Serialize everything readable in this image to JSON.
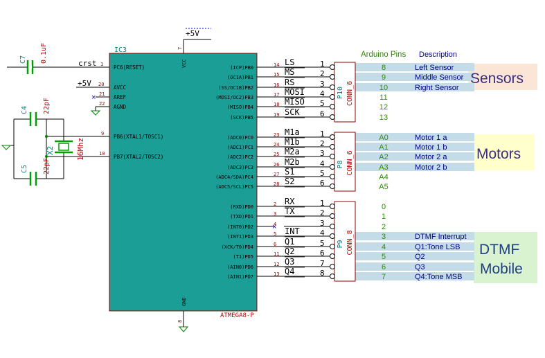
{
  "chip": {
    "ref": "IC3",
    "part": "ATMEGA8-P",
    "vcc_label": "VCC",
    "gnd_label": "GND",
    "vcc_pin": "7",
    "gnd_pin": "8",
    "supply": "+5V",
    "left_pins": [
      {
        "num": "1",
        "name": "PC6(RESET)",
        "net": "crst"
      },
      {
        "num": "20",
        "name": "AVCC",
        "net": "+5V"
      },
      {
        "num": "21",
        "name": "AREF",
        "net": ""
      },
      {
        "num": "22",
        "name": "AGND",
        "net": ""
      },
      {
        "num": "9",
        "name": "PB6(XTAL1/TOSC1)",
        "net": ""
      },
      {
        "num": "10",
        "name": "PB7(XTAL2/TOSC2)",
        "net": ""
      }
    ],
    "right_pins": [
      {
        "num": "14",
        "name": "(ICP)PB0",
        "net": "LS"
      },
      {
        "num": "15",
        "name": "(OC1A)PB1",
        "net": "MS"
      },
      {
        "num": "16",
        "name": "(SS/OC1B)PB2",
        "net": "RS"
      },
      {
        "num": "17",
        "name": "(MOSI/OC2)PB3",
        "net": "MOSI"
      },
      {
        "num": "18",
        "name": "(MISO)PB4",
        "net": "MISO"
      },
      {
        "num": "19",
        "name": "(SCK)PB5",
        "net": "SCK"
      },
      {
        "num": "23",
        "name": "(ADC0)PC0",
        "net": "M1a"
      },
      {
        "num": "24",
        "name": "(ADC1)PC1",
        "net": "M1b"
      },
      {
        "num": "25",
        "name": "(ADC2)PC2",
        "net": "M2a"
      },
      {
        "num": "26",
        "name": "(ADC3)PC3",
        "net": "M2b"
      },
      {
        "num": "27",
        "name": "(ADC4/SDA)PC4",
        "net": "S1"
      },
      {
        "num": "28",
        "name": "(ADC5/SCL)PC5",
        "net": "S2"
      },
      {
        "num": "2",
        "name": "(RXD)PD0",
        "net": "RX"
      },
      {
        "num": "3",
        "name": "(TXD)PD1",
        "net": "TX"
      },
      {
        "num": "4",
        "name": "(INT0)PD2",
        "net": ""
      },
      {
        "num": "5",
        "name": "(INT1)PD3",
        "net": "INT"
      },
      {
        "num": "6",
        "name": "(XCK/T0)PD4",
        "net": "Q1"
      },
      {
        "num": "11",
        "name": "(T1)PD5",
        "net": "Q2"
      },
      {
        "num": "12",
        "name": "(AIN0)PD6",
        "net": "Q3"
      },
      {
        "num": "13",
        "name": "(AIN1)PD7",
        "net": "Q4"
      }
    ]
  },
  "components": {
    "c7": {
      "ref": "C7",
      "value": "0.1uF"
    },
    "c4": {
      "ref": "C4",
      "value": "22pF"
    },
    "c5": {
      "ref": "C5",
      "value": "22pF"
    },
    "x2": {
      "ref": "X2",
      "value": "16Mhz"
    }
  },
  "connectors": [
    {
      "ref": "P10",
      "type": "CONN_6",
      "pins": [
        "1",
        "2",
        "3",
        "4",
        "5",
        "6"
      ]
    },
    {
      "ref": "P8",
      "type": "CONN_6",
      "pins": [
        "1",
        "2",
        "3",
        "4",
        "5",
        "6"
      ]
    },
    {
      "ref": "P9",
      "type": "CONN_8",
      "pins": [
        "1",
        "2",
        "3",
        "4",
        "5",
        "6",
        "7",
        "8"
      ]
    }
  ],
  "table_headers": {
    "arduino": "Arduino Pins",
    "description": "Description"
  },
  "group1": {
    "title": "Sensors",
    "color": "#fbe5d6",
    "rows": [
      {
        "pin": "8",
        "desc": "Left Sensor"
      },
      {
        "pin": "9",
        "desc": "Middle Sensor"
      },
      {
        "pin": "10",
        "desc": "Right Sensor"
      },
      {
        "pin": "11",
        "desc": ""
      },
      {
        "pin": "12",
        "desc": ""
      },
      {
        "pin": "13",
        "desc": ""
      }
    ]
  },
  "group2": {
    "title": "Motors",
    "color": "#ffffcc",
    "rows": [
      {
        "pin": "A0",
        "desc": "Motor 1 a"
      },
      {
        "pin": "A1",
        "desc": "Motor 1 b"
      },
      {
        "pin": "A2",
        "desc": "Motor 2 a"
      },
      {
        "pin": "A3",
        "desc": "Motor 2 b"
      },
      {
        "pin": "A4",
        "desc": ""
      },
      {
        "pin": "A5",
        "desc": ""
      }
    ]
  },
  "group3": {
    "title1": "DTMF",
    "title2": "Mobile",
    "color": "#d9f2d0",
    "rows": [
      {
        "pin": "0",
        "desc": ""
      },
      {
        "pin": "1",
        "desc": ""
      },
      {
        "pin": "2",
        "desc": ""
      },
      {
        "pin": "3",
        "desc": "DTMF Interrupt"
      },
      {
        "pin": "4",
        "desc": "Q1:Tone LSB"
      },
      {
        "pin": "5",
        "desc": "Q2"
      },
      {
        "pin": "6",
        "desc": "Q3"
      },
      {
        "pin": "7",
        "desc": "Q4:Tone MSB"
      }
    ]
  },
  "colors": {
    "chip_fill": "#1a9e96",
    "chip_stroke": "#8c0000",
    "wire": "#000000",
    "pin_text": "#8c0000",
    "ref_teal": "#008484",
    "value_red": "#c00000",
    "cap_green": "#00a000",
    "no_connect": "#0000c8",
    "arduino_green": "#2e8b00",
    "desc_navy": "#00007f",
    "row_stripe": "#c4dce8"
  }
}
